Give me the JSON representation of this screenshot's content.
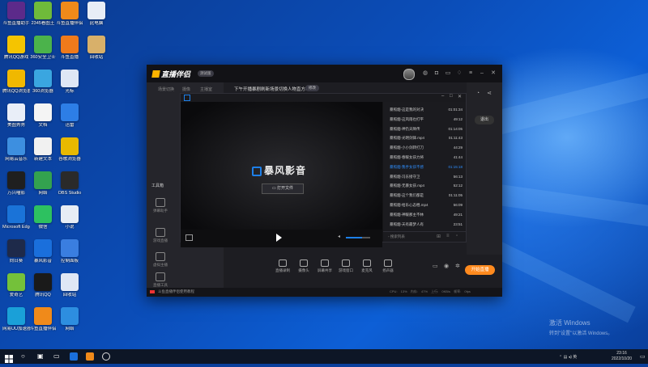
{
  "colors": {
    "accent": "#1d7fe8",
    "live": "#ff8a1e",
    "active_track": "#2f8fff"
  },
  "desktop_icons": [
    {
      "label": "斗鱼直播助手",
      "color": "#5c2a8a",
      "col": 0,
      "row": 0
    },
    {
      "label": "2345看图王",
      "color": "#6fba3a",
      "col": 1,
      "row": 0
    },
    {
      "label": "斗鱼直播伴侣",
      "color": "#f08a1a",
      "col": 2,
      "row": 0
    },
    {
      "label": "此电脑",
      "color": "#e8edf6",
      "col": 3,
      "row": 0
    },
    {
      "label": "腾讯QQ游戏",
      "color": "#f5c400",
      "col": 0,
      "row": 1
    },
    {
      "label": "360安全卫士",
      "color": "#4bb34b",
      "col": 1,
      "row": 1
    },
    {
      "label": "斗鱼直播",
      "color": "#ef7a1b",
      "col": 2,
      "row": 1
    },
    {
      "label": "回收站",
      "color": "#d8b06a",
      "col": 3,
      "row": 1
    },
    {
      "label": "腾讯QQ浏览器",
      "color": "#f0b800",
      "col": 0,
      "row": 2
    },
    {
      "label": "360浏览器",
      "color": "#3aa6e0",
      "col": 1,
      "row": 2
    },
    {
      "label": "光标",
      "color": "#dfe7f5",
      "col": 2,
      "row": 2
    },
    {
      "label": "美图秀秀",
      "color": "#e9eef8",
      "col": 0,
      "row": 3
    },
    {
      "label": "文档",
      "color": "#f4f4f4",
      "col": 1,
      "row": 3
    },
    {
      "label": "迅雷",
      "color": "#2d7ee6",
      "col": 2,
      "row": 3
    },
    {
      "label": "网易云音乐",
      "color": "#3d8fe0",
      "col": 0,
      "row": 4
    },
    {
      "label": "新建文本",
      "color": "#f1f1f1",
      "col": 1,
      "row": 4
    },
    {
      "label": "谷歌浏览器",
      "color": "#e8b900",
      "col": 2,
      "row": 4
    },
    {
      "label": "万兴喵影",
      "color": "#1f1f1f",
      "col": 0,
      "row": 5
    },
    {
      "label": "网络",
      "color": "#33a24f",
      "col": 1,
      "row": 5
    },
    {
      "label": "OBS Studio",
      "color": "#2a2a2a",
      "col": 2,
      "row": 5
    },
    {
      "label": "Microsoft Edge",
      "color": "#1a73d8",
      "col": 0,
      "row": 6
    },
    {
      "label": "微信",
      "color": "#2dc160",
      "col": 1,
      "row": 6
    },
    {
      "label": "小说",
      "color": "#e7edf5",
      "col": 2,
      "row": 6
    },
    {
      "label": "向日葵",
      "color": "#1e2a4a",
      "col": 0,
      "row": 7
    },
    {
      "label": "暴风影音",
      "color": "#1a6fdc",
      "col": 1,
      "row": 7
    },
    {
      "label": "控制面板",
      "color": "#3a7ee0",
      "col": 2,
      "row": 7
    },
    {
      "label": "爱奇艺",
      "color": "#74c13a",
      "col": 0,
      "row": 8
    },
    {
      "label": "腾讯QQ",
      "color": "#1a1a1a",
      "col": 1,
      "row": 8
    },
    {
      "label": "回收站",
      "color": "#dfe7f5",
      "col": 2,
      "row": 8
    },
    {
      "label": "网易UU加速器",
      "color": "#1aa0d8",
      "col": 0,
      "row": 9
    },
    {
      "label": "斗鱼直播伴侣",
      "color": "#f08a1a",
      "col": 1,
      "row": 9
    },
    {
      "label": "网络",
      "color": "#2d8ee0",
      "col": 2,
      "row": 9
    }
  ],
  "window": {
    "brand": "直播伴侣",
    "badge": "测试版",
    "nav_tabs": [
      "场景切换",
      "摄像",
      "主播室"
    ],
    "tool_label": "工具箱",
    "nav_items": [
      "弹幕助手",
      "游戏直播",
      "虚拟主播",
      "直播工具"
    ],
    "topic": "下午开播暴剧刷新场景切换人物直方#",
    "topic_button": "修改",
    "exit_label": "退出",
    "bottom_items": [
      "直播录制",
      "摄像头",
      "屏幕共享",
      "游戏窗口",
      "麦克风",
      "扬声器"
    ],
    "live_button": "开始直播",
    "status": "斗鱼直播伴侣使用教程",
    "stats": "CPU: 13%  内存: 47%  上行: 0KB/s  帧率: 0fps"
  },
  "player": {
    "title": "暴风影音",
    "open_button": "打开文件",
    "search_placeholder": "搜索列表",
    "playlist": [
      {
        "name": "暴照烟-这是我的对决",
        "time": "01:01:34",
        "active": false
      },
      {
        "name": "暴照烟-这风雨也打平",
        "time": "49:12",
        "active": false
      },
      {
        "name": "暴照烟-神仍天降传",
        "time": "01:14:05",
        "active": false
      },
      {
        "name": "暴照烟-光明剑锋.mp4",
        "time": "01:11:43",
        "active": false
      },
      {
        "name": "暴照烟-小小剑转打刀",
        "time": "44:29",
        "active": false
      },
      {
        "name": "暴照烟-春暖女孩力将",
        "time": "41:44",
        "active": false
      },
      {
        "name": "暴照烟-我手女孩不感",
        "time": "01:15:18",
        "active": true
      },
      {
        "name": "暴照烟-冯东接守卫",
        "time": "56:13",
        "active": false
      },
      {
        "name": "暴照烟-无暴女孩.mp4",
        "time": "52:12",
        "active": false
      },
      {
        "name": "暴照烟-这个我们都是",
        "time": "01:11:05",
        "active": false
      },
      {
        "name": "暴照烟-给乐心态棍.mp4",
        "time": "56:09",
        "active": false
      },
      {
        "name": "暴照烟-神暖那主不林",
        "time": "49:21",
        "active": false
      },
      {
        "name": "暴照烟-天有最梦人有",
        "time": "23:51",
        "active": false
      }
    ]
  },
  "watermark": {
    "line1": "激活 Windows",
    "line2": "转到\"设置\"以激活 Windows。"
  },
  "taskbar": {
    "ime": "英",
    "time": "23:16",
    "date": "2022/10/20"
  }
}
